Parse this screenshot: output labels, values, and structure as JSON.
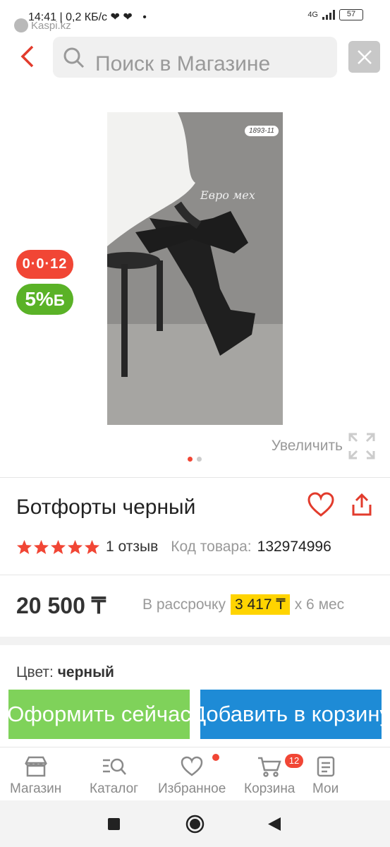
{
  "status_bar": {
    "time": "14:41",
    "speed": "0,2 КБ/с",
    "app_label": "Kaspi.kz",
    "network": "4G",
    "battery": "57"
  },
  "search": {
    "placeholder": "Поиск в Магазине"
  },
  "gallery": {
    "image_tag": "1893-11",
    "watermark": "Евро мех",
    "zoom_label": "Увеличить",
    "current_slide": 1,
    "slide_count": 2
  },
  "badges": {
    "installment": "0·0·12",
    "bonus_percent": "5%",
    "bonus_symbol": "Б"
  },
  "product": {
    "title": "Ботфорты черный",
    "rating": 5,
    "reviews": "1 отзыв",
    "code_label": "Код товара:",
    "code_value": "132974996",
    "price": "20 500 ₸",
    "installment_prefix": "В рассрочку",
    "installment_amount": "3 417 ₸",
    "installment_suffix": "х 6 мес",
    "color_label": "Цвет:",
    "color_value": "черный"
  },
  "actions": {
    "buy_now": "Оформить сейчас",
    "add_to_cart": "Добавить в корзину"
  },
  "nav": {
    "items": [
      {
        "label": "Магазин",
        "icon": "shop-icon"
      },
      {
        "label": "Каталог",
        "icon": "catalog-icon"
      },
      {
        "label": "Избранное",
        "icon": "heart-icon"
      },
      {
        "label": "Корзина",
        "icon": "cart-icon"
      },
      {
        "label": "Мои",
        "icon": "orders-icon"
      }
    ],
    "cart_badge": "12"
  },
  "colors": {
    "accent_red": "#f14635",
    "buy_green": "#7fd25a",
    "cart_blue": "#1e8bd6",
    "installment_yellow": "#ffd400"
  }
}
